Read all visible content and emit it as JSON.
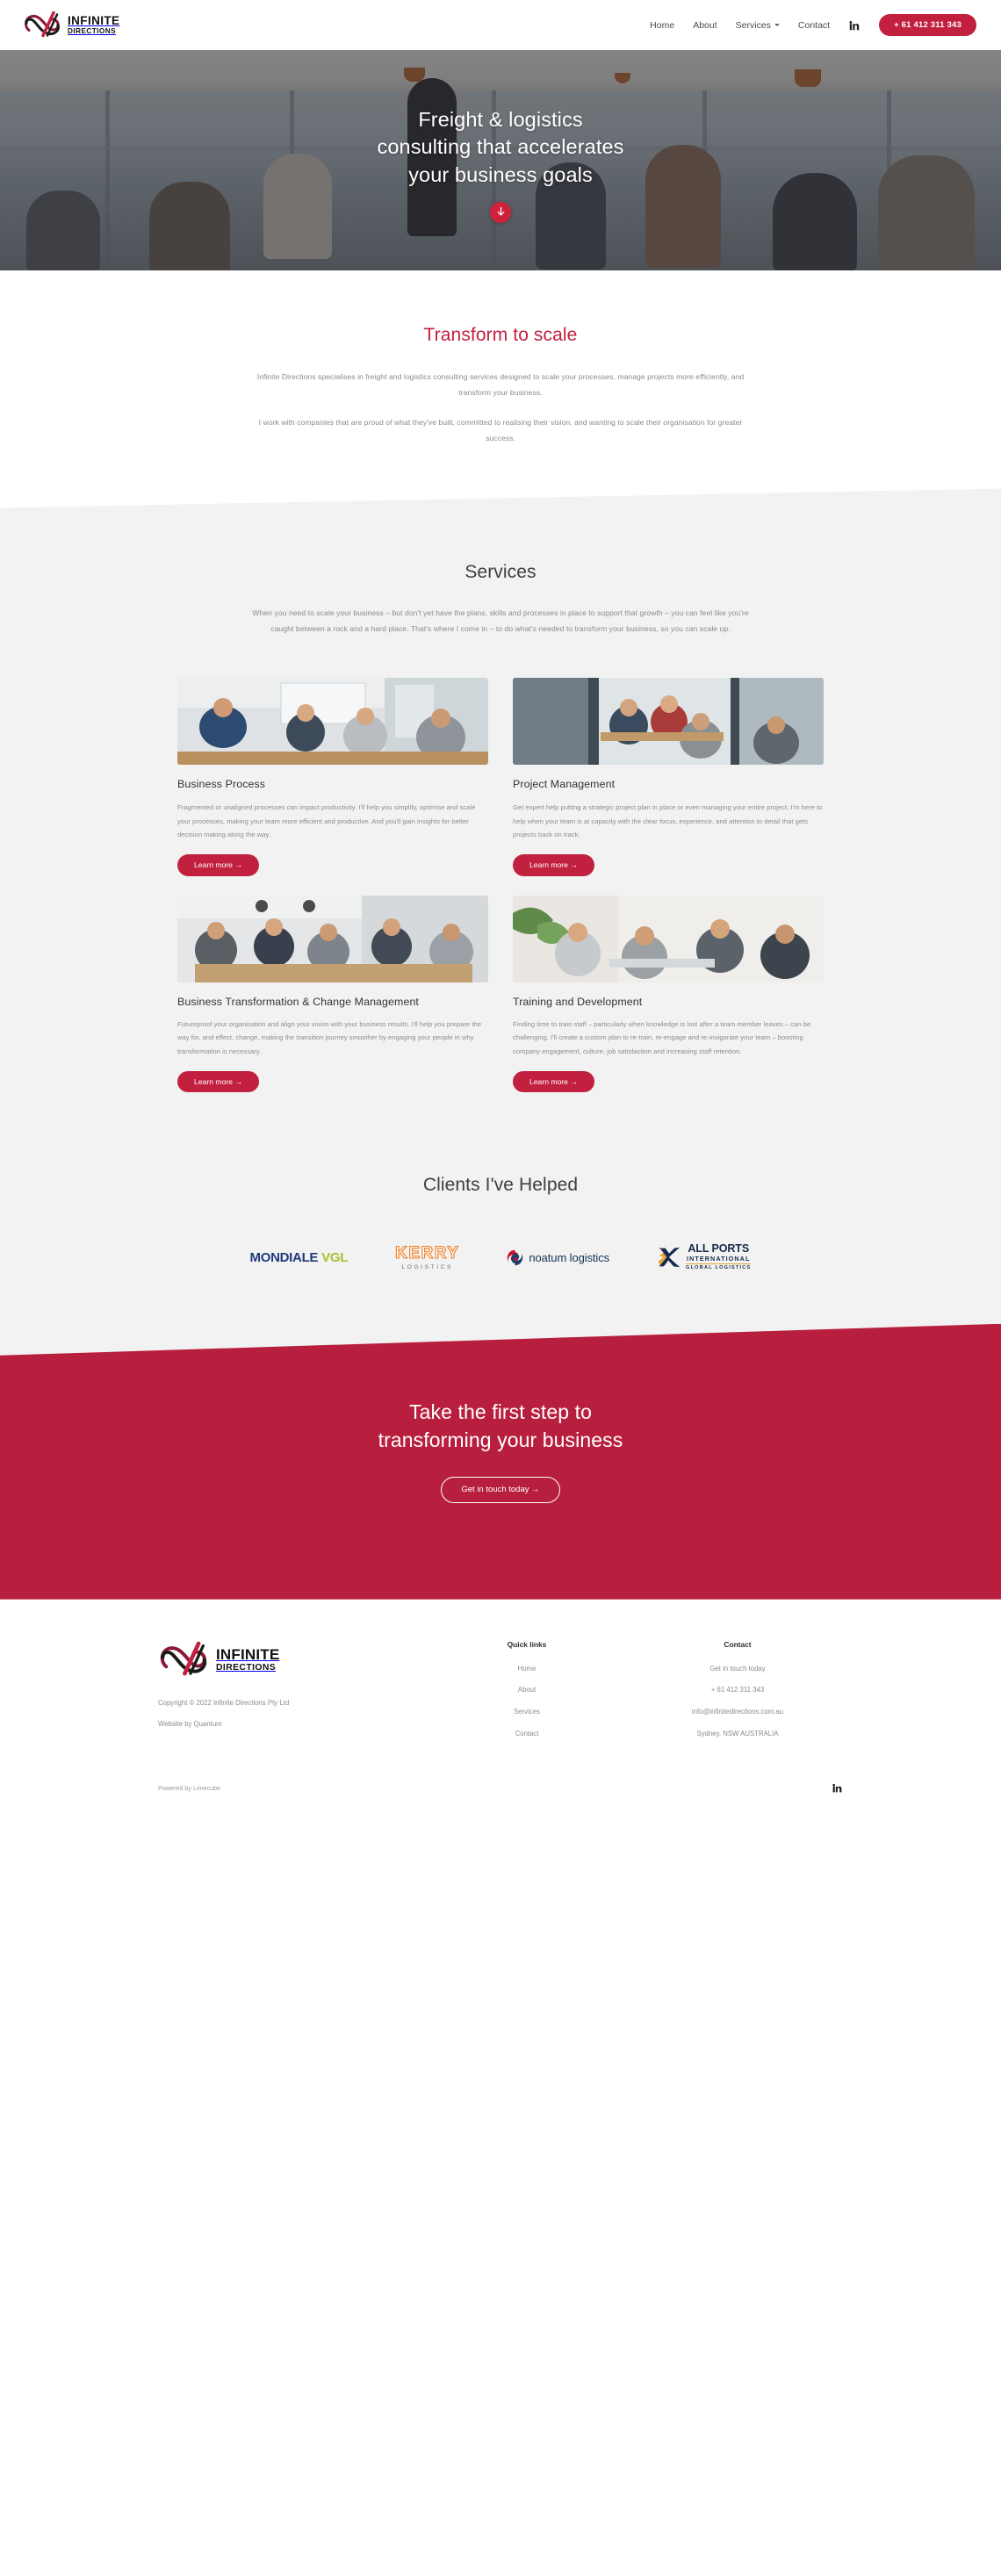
{
  "brand": {
    "name_line1": "INFINITE",
    "name_line2": "DIRECTIONS",
    "accent_color": "#c2203f"
  },
  "header": {
    "nav": [
      {
        "label": "Home",
        "has_caret": false
      },
      {
        "label": "About",
        "has_caret": false
      },
      {
        "label": "Services",
        "has_caret": true
      },
      {
        "label": "Contact",
        "has_caret": false
      }
    ],
    "linkedin_icon": "linkedin-icon",
    "phone_button": "+ 61 412 311 343"
  },
  "hero": {
    "title_line1": "Freight & logistics",
    "title_line2": "consulting that accelerates",
    "title_line3": "your business goals",
    "scroll_icon": "arrow-down-icon"
  },
  "transform": {
    "heading": "Transform to scale",
    "paragraph1": "Infinite Directions specialises in freight and logistics consulting services designed to scale your processes, manage projects more efficiently, and transform your business.",
    "paragraph2": "I work with companies that are proud of what they've built, committed to realising their vision, and wanting to scale their organisation for greater success."
  },
  "services": {
    "heading": "Services",
    "intro": "When you need to scale your business – but don't yet have the plans, skills and processes in place to support that growth – you can feel like you're caught between a rock and a hard place. That's where I come in – to do what's needed to transform your business, so you can scale up.",
    "cards": [
      {
        "title": "Business Process",
        "body": "Fragmented or unaligned processes can impact productivity. I'll help you simplify, optimise and scale your processes, making your team more efficient and productive. And you'll gain insights for better decision making along the way.",
        "cta": "Learn more  →"
      },
      {
        "title": "Project Management",
        "body": "Get expert help putting a strategic project plan in place or even managing your entire project. I'm here to help when your team is at capacity with the clear focus, experience, and attention to detail that gets projects back on track.",
        "cta": "Learn more  →"
      },
      {
        "title": "Business Transformation & Change Management",
        "body": "Futureproof your organisation and align your vision with your business results. I'll help you prepare the way for, and effect, change, making the transition journey smoother by engaging your people in why transformation is necessary.",
        "cta": "Learn more  →"
      },
      {
        "title": "Training and Development",
        "body": "Finding time to train staff – particularly when knowledge is lost after a team member leaves – can be challenging. I'll create a custom plan to re-train, re-engage and re-invigorate your team – boosting company engagement, culture, job satisfaction and increasing staff retention.",
        "cta": "Learn more  →"
      }
    ]
  },
  "clients": {
    "heading": "Clients I've Helped",
    "logos": [
      {
        "name": "mondiale-vgl-logo",
        "part1": "MONDIALE",
        "part2": "VGL",
        "color1": "#1f3a7a",
        "color2": "#a8c02e"
      },
      {
        "name": "kerry-logistics-logo",
        "part1": "KERRY",
        "part2": "LOGISTICS",
        "color1": "#ef7d22",
        "color2": "#6e6e6e"
      },
      {
        "name": "noatum-logistics-logo",
        "part1": "noatum logistics",
        "color1": "#123456"
      },
      {
        "name": "all-ports-international-logo",
        "part1": "ALL PORTS",
        "part2": "INTERNATIONAL",
        "part3": "GLOBAL LOGISTICS",
        "color1": "#17294e",
        "color2": "#e8a33d"
      }
    ]
  },
  "cta": {
    "heading_line1": "Take the first step to",
    "heading_line2": "transforming your business",
    "button": "Get in touch today →",
    "background_color": "#b81f3e"
  },
  "footer": {
    "copyright": "Copyright © 2022 Infinite Directions Pty Ltd",
    "website_by": "Website by Quantum",
    "quick_links": {
      "heading": "Quick links",
      "items": [
        "Home",
        "About",
        "Services",
        "Contact"
      ]
    },
    "contact": {
      "heading": "Contact",
      "items": [
        "Get in touch today",
        "+ 61 412 311 343",
        "info@infinitedirections.com.au",
        "Sydney, NSW AUSTRALIA"
      ]
    },
    "powered_by": "Powered by Limecube",
    "linkedin_icon": "linkedin-icon"
  }
}
